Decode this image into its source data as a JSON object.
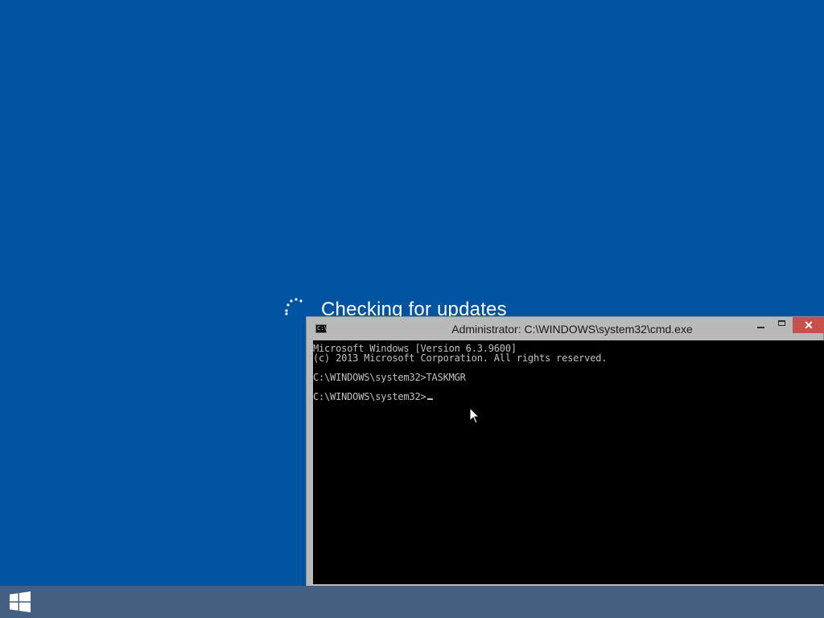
{
  "setup": {
    "status_text": "Checking for updates"
  },
  "console": {
    "title": "Administrator: C:\\WINDOWS\\system32\\cmd.exe",
    "icon_label": "C:\\",
    "buttons": {
      "minimize": "minimize-icon",
      "maximize": "maximize-icon",
      "close": "close-icon",
      "close_glyph": "✕"
    },
    "lines": [
      "Microsoft Windows [Version 6.3.9600]",
      "(c) 2013 Microsoft Corporation. All rights reserved.",
      "",
      "C:\\WINDOWS\\system32>TASKMGR",
      "",
      "C:\\WINDOWS\\system32>"
    ]
  },
  "taskbar": {
    "start_icon": "windows-logo-icon"
  },
  "colors": {
    "desktop": "#0053a0",
    "taskbar": "#445f80",
    "console_bg": "#000000",
    "console_text": "#c0c0c0",
    "close_button": "#c7504c"
  }
}
